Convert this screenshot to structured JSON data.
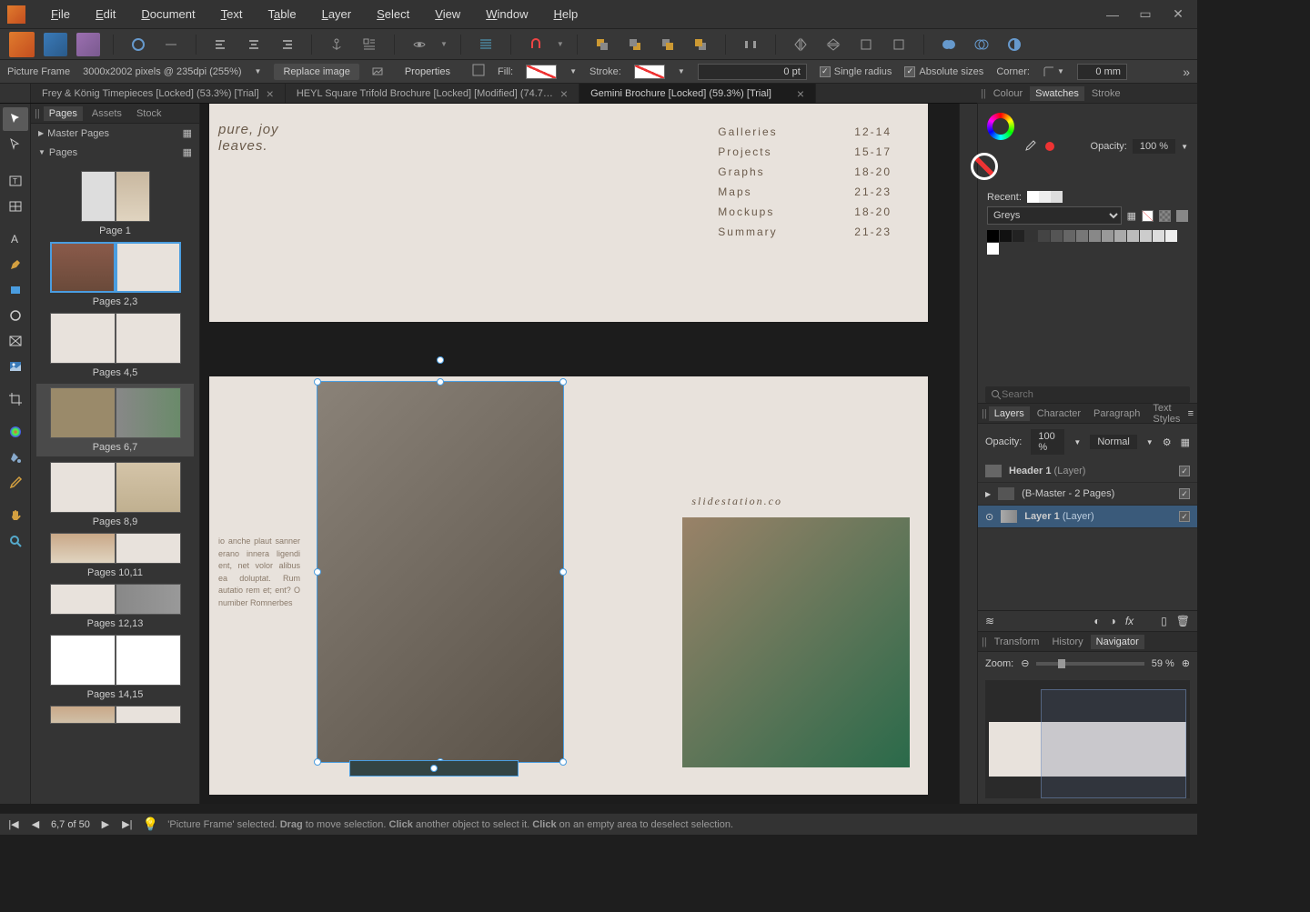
{
  "menu": {
    "items": [
      "File",
      "Edit",
      "Document",
      "Text",
      "Table",
      "Layer",
      "Select",
      "View",
      "Window",
      "Help"
    ]
  },
  "context": {
    "label": "Picture Frame",
    "doc_size": "3000x2002 pixels @ 235dpi (255%)",
    "replace_btn": "Replace image",
    "properties_btn": "Properties",
    "fill_label": "Fill:",
    "stroke_label": "Stroke:",
    "stroke_width": "0 pt",
    "single_radius": "Single radius",
    "absolute_sizes": "Absolute sizes",
    "corner_label": "Corner:",
    "corner_value": "0 mm"
  },
  "tabs": [
    {
      "label": "Frey & König Timepieces [Locked] (53.3%) [Trial]",
      "active": false
    },
    {
      "label": "HEYL Square Trifold Brochure [Locked] [Modified] (74.7…",
      "active": false
    },
    {
      "label": "Gemini Brochure [Locked] (59.3%) [Trial]",
      "active": true
    }
  ],
  "pages_panel": {
    "tabs": [
      "Pages",
      "Assets",
      "Stock"
    ],
    "master": "Master Pages",
    "pages": "Pages",
    "items": [
      {
        "label": "Page 1"
      },
      {
        "label": "Pages 2,3",
        "selected": true
      },
      {
        "label": "Pages 4,5"
      },
      {
        "label": "Pages 6,7",
        "hover": true
      },
      {
        "label": "Pages 8,9"
      },
      {
        "label": "Pages 10,11"
      },
      {
        "label": "Pages 12,13"
      },
      {
        "label": "Pages 14,15"
      }
    ]
  },
  "canvas": {
    "cursive1": "pure, joy",
    "cursive2": "leaves.",
    "toc": [
      {
        "l": "Galleries",
        "r": "12-14"
      },
      {
        "l": "Projects",
        "r": "15-17"
      },
      {
        "l": "Graphs",
        "r": "18-20"
      },
      {
        "l": "Maps",
        "r": "21-23"
      },
      {
        "l": "Mockups",
        "r": "18-20"
      },
      {
        "l": "Summary",
        "r": "21-23"
      }
    ],
    "sitetxt": "slidestation.co",
    "body": "io anche plaut sanner erano innera ligendi ent, net volor alibus ea doluptat. Rum autatio rem et; ent? O numiber Romnerbes"
  },
  "right": {
    "color_tabs": [
      "Colour",
      "Swatches",
      "Stroke"
    ],
    "opacity_label": "Opacity:",
    "opacity_value": "100 %",
    "recent_label": "Recent:",
    "palette": "Greys",
    "search_placeholder": "Search",
    "layer_tabs": [
      "Layers",
      "Character",
      "Paragraph",
      "Text Styles"
    ],
    "layers_opacity_label": "Opacity:",
    "layers_opacity": "100 %",
    "blend": "Normal",
    "layers": [
      {
        "name": "Header 1",
        "suffix": "(Layer)",
        "sel": false,
        "bold": true
      },
      {
        "name": "(B-Master - 2 Pages)",
        "suffix": "",
        "sel": false
      },
      {
        "name": "Layer 1",
        "suffix": "(Layer)",
        "sel": true,
        "bold": true
      }
    ],
    "nav_tabs": [
      "Transform",
      "History",
      "Navigator"
    ],
    "zoom_label": "Zoom:",
    "zoom_value": "59 %"
  },
  "status": {
    "page_pos": "6,7 of 50",
    "hint": "'Picture Frame' selected. Drag to move selection. Click another object to select it. Click on an empty area to deselect selection."
  }
}
